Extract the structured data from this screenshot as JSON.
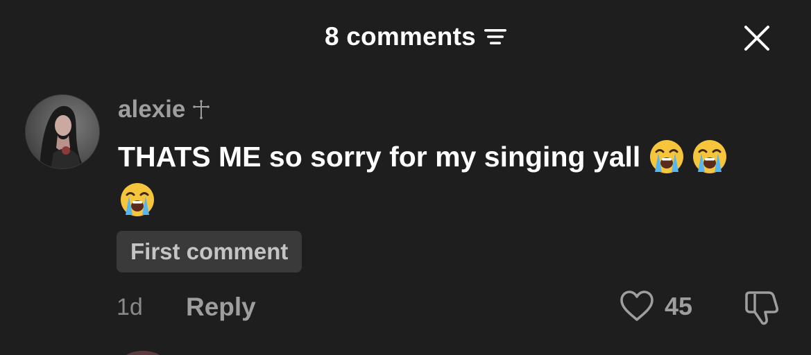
{
  "header": {
    "comment_count_label": "8 comments",
    "sort_icon": "sort-lines-icon",
    "close_icon": "close-icon"
  },
  "comment": {
    "username": "alexie",
    "username_icon": "cross-icon",
    "text": "THATS ME so sorry for my singing yall",
    "emojis": [
      "loudly-crying-face",
      "loudly-crying-face",
      "loudly-crying-face"
    ],
    "badge": "First comment",
    "time": "1d",
    "reply_label": "Reply",
    "like_count": "45",
    "like_icon": "heart-icon",
    "dislike_icon": "thumbs-down-icon"
  },
  "colors": {
    "background": "#1e1e1e",
    "primary_text": "#ffffff",
    "secondary_text": "#9e9e9e",
    "badge_bg": "#3a3a3a"
  }
}
